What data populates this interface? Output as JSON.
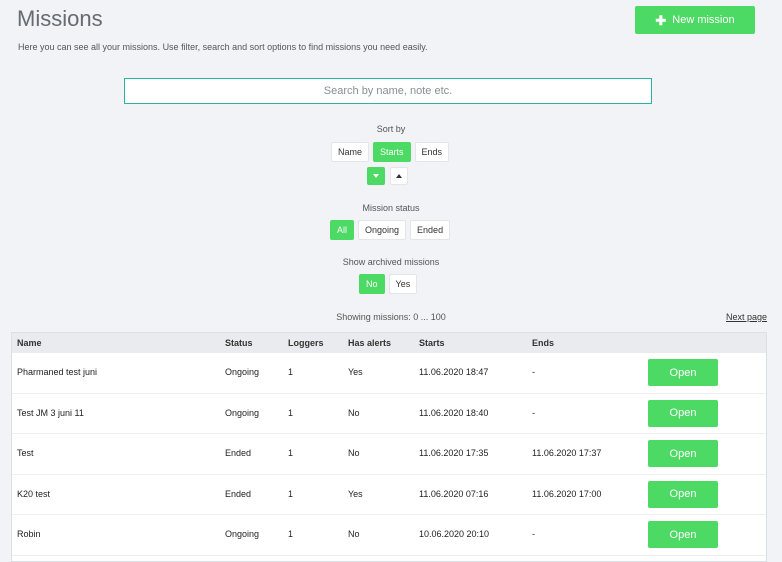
{
  "header": {
    "title": "Missions",
    "subtitle": "Here you can see all your missions. Use filter, search and sort options to find missions you need easily.",
    "new_button_icon": "plus-icon",
    "new_button_label": "New mission"
  },
  "search": {
    "placeholder": "Search by name, note etc.",
    "value": ""
  },
  "sort": {
    "label": "Sort by",
    "options": [
      "Name",
      "Starts",
      "Ends"
    ],
    "selected": "Starts",
    "direction": "descending"
  },
  "status_filter": {
    "label": "Mission status",
    "options": [
      "All",
      "Ongoing",
      "Ended"
    ],
    "selected": "All"
  },
  "archived_filter": {
    "label": "Show archived missions",
    "options": [
      "No",
      "Yes"
    ],
    "selected": "No"
  },
  "pagination": {
    "showing": "Showing missions: 0 ... 100",
    "next_label": "Next page"
  },
  "table": {
    "columns": [
      "Name",
      "Status",
      "Loggers",
      "Has alerts",
      "Starts",
      "Ends"
    ],
    "rows": [
      {
        "name": "Pharmaned test juni",
        "status": "Ongoing",
        "loggers": "1",
        "alerts": "Yes",
        "starts": "11.06.2020 18:47",
        "ends": "-",
        "action": "Open"
      },
      {
        "name": "Test JM 3 juni 11",
        "status": "Ongoing",
        "loggers": "1",
        "alerts": "No",
        "starts": "11.06.2020 18:40",
        "ends": "-",
        "action": "Open"
      },
      {
        "name": "Test",
        "status": "Ended",
        "loggers": "1",
        "alerts": "No",
        "starts": "11.06.2020 17:35",
        "ends": "11.06.2020 17:37",
        "action": "Open"
      },
      {
        "name": "K20 test",
        "status": "Ended",
        "loggers": "1",
        "alerts": "Yes",
        "starts": "11.06.2020 07:16",
        "ends": "11.06.2020 17:00",
        "action": "Open"
      },
      {
        "name": "Robin",
        "status": "Ongoing",
        "loggers": "1",
        "alerts": "No",
        "starts": "10.06.2020 20:10",
        "ends": "-",
        "action": "Open"
      }
    ]
  },
  "colors": {
    "accent": "#4cd964",
    "search_border": "#2bb3a5",
    "background": "#f1f3f6"
  }
}
